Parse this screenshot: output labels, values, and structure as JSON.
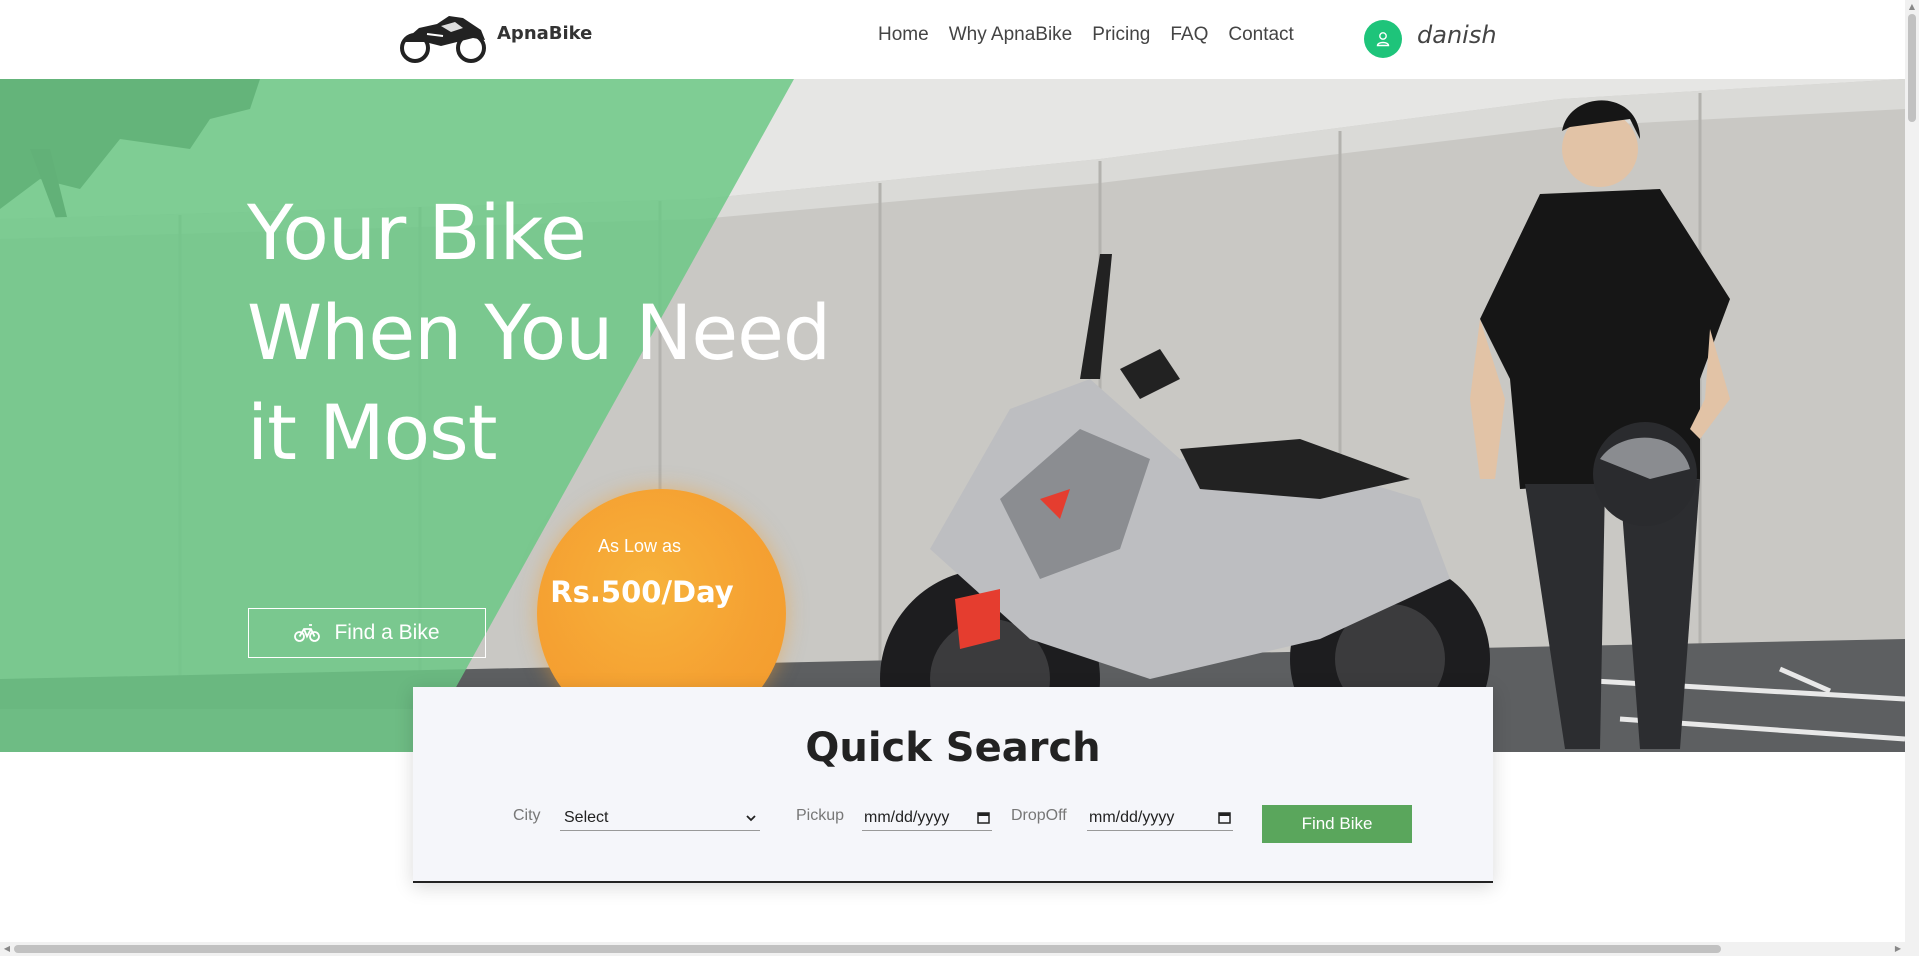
{
  "header": {
    "brand": "ApnaBike",
    "nav": [
      "Home",
      "Why ApnaBike",
      "Pricing",
      "FAQ",
      "Contact"
    ],
    "user_name": "danish",
    "user_icon": "user-icon"
  },
  "hero": {
    "title_lines": [
      "Your Bike",
      "When You Need",
      "it Most"
    ],
    "cta_label": "Find a Bike",
    "cta_icon": "bicycle-icon",
    "price_prefix": "As Low as",
    "price": "Rs.500/Day",
    "accent_green": "#6cc886",
    "badge_orange": "#f5a132"
  },
  "quick_search": {
    "title": "Quick Search",
    "city_label": "City",
    "city_value": "Select",
    "pickup_label": "Pickup",
    "pickup_placeholder": "mm/dd/yyyy",
    "dropoff_label": "DropOff",
    "dropoff_placeholder": "mm/dd/yyyy",
    "button_label": "Find Bike",
    "button_color": "#5aa65c"
  }
}
